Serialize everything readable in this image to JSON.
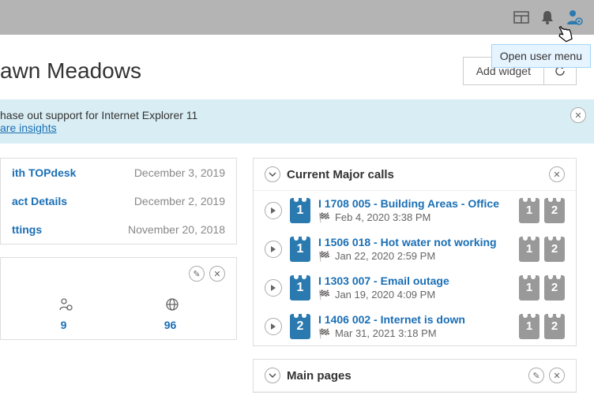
{
  "tooltip": "Open user menu",
  "page_title": "awn Meadows",
  "header": {
    "add_widget": "Add widget"
  },
  "notice": {
    "line1": "hase out support for Internet Explorer 11",
    "link": "are insights"
  },
  "left": {
    "rows": [
      {
        "label": "ith TOPdesk",
        "date": "December 3, 2019"
      },
      {
        "label": "act Details",
        "date": "December 2, 2019"
      },
      {
        "label": "ttings",
        "date": "November 20, 2018"
      }
    ],
    "stats": {
      "a": "9",
      "b": "96"
    }
  },
  "major": {
    "title": "Current Major calls",
    "calls": [
      {
        "badge": "1",
        "title": "I 1708 005 - Building Areas - Office",
        "meta": "Feb 4, 2020 3:38 PM"
      },
      {
        "badge": "1",
        "title": "I 1506 018 - Hot water not working",
        "meta": "Jan 22, 2020 2:59 PM"
      },
      {
        "badge": "1",
        "title": "I 1303 007 - Email outage",
        "meta": "Jan 19, 2020 4:09 PM"
      },
      {
        "badge": "2",
        "title": "I 1406 002 - Internet is down",
        "meta": "Mar 31, 2021 3:18 PM"
      }
    ]
  },
  "mainpages": {
    "title": "Main pages"
  }
}
